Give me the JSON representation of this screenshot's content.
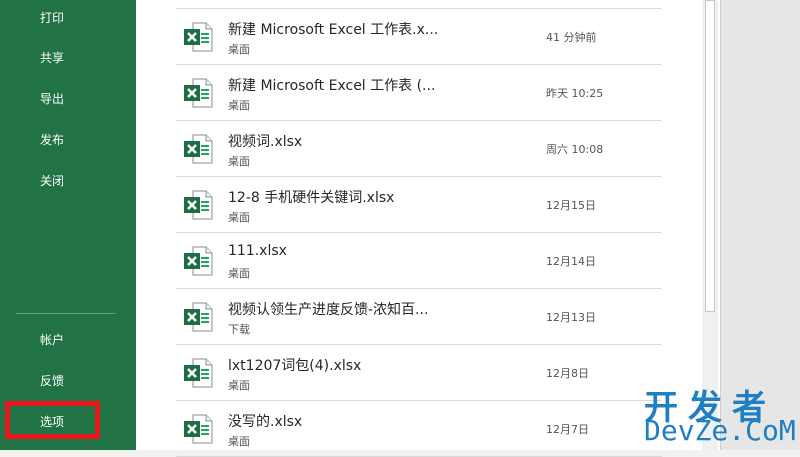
{
  "nav": {
    "top_items": [
      "打印",
      "共享",
      "导出",
      "发布",
      "关闭"
    ],
    "bottom_items": [
      "帐户",
      "反馈",
      "选项"
    ],
    "background": "#217346",
    "highlight_color": "#e8161b"
  },
  "recent_files": [
    {
      "name": "新建 Microsoft Excel 工作表.x...",
      "location": "桌面",
      "date": "41 分钟前",
      "icon": "excel-file-icon"
    },
    {
      "name": "新建 Microsoft Excel 工作表 (...",
      "location": "桌面",
      "date": "昨天 10:25",
      "icon": "excel-file-icon"
    },
    {
      "name": "视频词.xlsx",
      "location": "桌面",
      "date": "周六 10:08",
      "icon": "excel-file-icon"
    },
    {
      "name": "12-8 手机硬件关键词.xlsx",
      "location": "桌面",
      "date": "12月15日",
      "icon": "excel-file-icon"
    },
    {
      "name": "111.xlsx",
      "location": "桌面",
      "date": "12月14日",
      "icon": "excel-file-icon"
    },
    {
      "name": "视频认领生产进度反馈-浓知百...",
      "location": "下载",
      "date": "12月13日",
      "icon": "excel-file-icon"
    },
    {
      "name": "lxt1207词包(4).xlsx",
      "location": "桌面",
      "date": "12月8日",
      "icon": "excel-file-icon"
    },
    {
      "name": "没写的.xlsx",
      "location": "桌面",
      "date": "12月7日",
      "icon": "excel-file-icon"
    }
  ],
  "watermark": {
    "cn": "开发者",
    "en": "DevZe.CoM"
  },
  "excel_green": "#1d6f42"
}
